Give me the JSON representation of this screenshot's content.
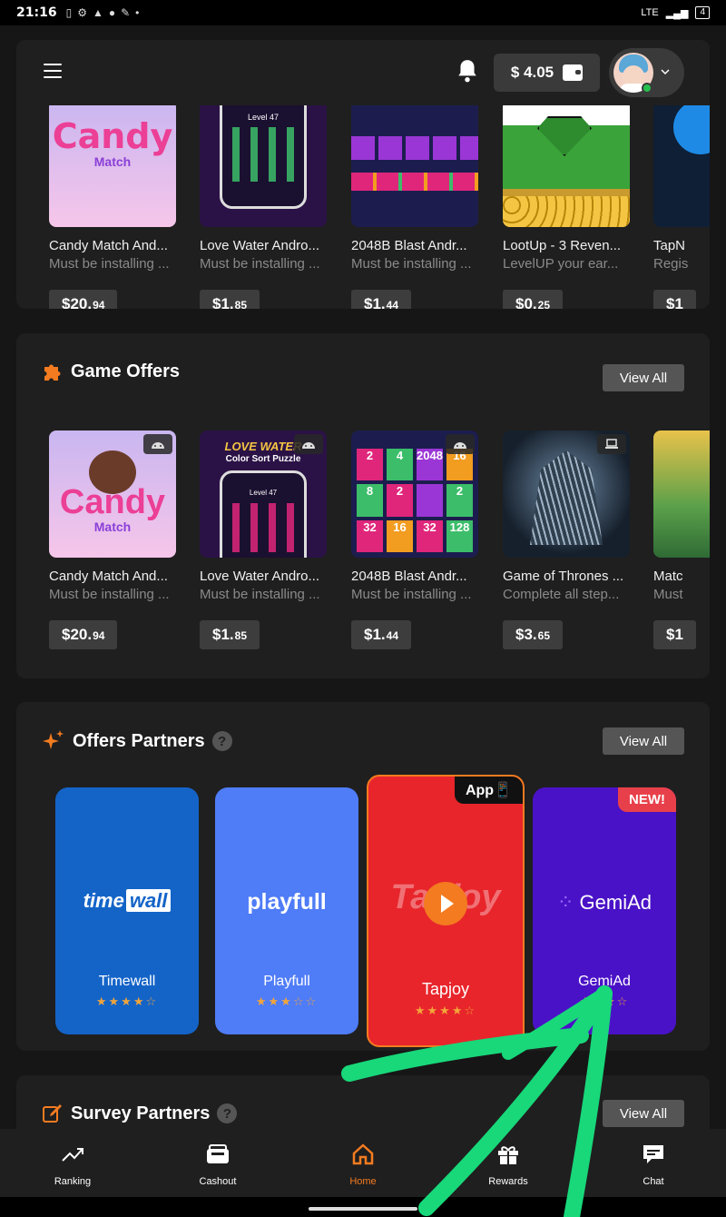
{
  "status_bar": {
    "time": "21:16",
    "network": "LTE",
    "battery": "4"
  },
  "header": {
    "balance": "$ 4.05"
  },
  "top_offers": {
    "cards": [
      {
        "title": "Candy Match And...",
        "subtitle": "Must be installing ...",
        "price_main": "$20.",
        "price_cents": "94"
      },
      {
        "title": "Love Water Andro...",
        "subtitle": "Must be installing ...",
        "price_main": "$1.",
        "price_cents": "85"
      },
      {
        "title": "2048B Blast Andr...",
        "subtitle": "Must be installing ...",
        "price_main": "$1.",
        "price_cents": "44"
      },
      {
        "title": "LootUp - 3 Reven...",
        "subtitle": "LevelUP your ear...",
        "price_main": "$0.",
        "price_cents": "25"
      },
      {
        "title": "TapN",
        "subtitle": "Regis",
        "price_main": "$1",
        "price_cents": ""
      }
    ]
  },
  "game_offers": {
    "title": "Game Offers",
    "view_all": "View All",
    "cards": [
      {
        "title": "Candy Match And...",
        "subtitle": "Must be installing ...",
        "price_main": "$20.",
        "price_cents": "94",
        "platform": "android-icon"
      },
      {
        "title": "Love Water Andro...",
        "subtitle": "Must be installing ...",
        "price_main": "$1.",
        "price_cents": "85",
        "platform": "android-icon"
      },
      {
        "title": "2048B Blast Andr...",
        "subtitle": "Must be installing ...",
        "price_main": "$1.",
        "price_cents": "44",
        "platform": "android-icon"
      },
      {
        "title": "Game of Thrones ...",
        "subtitle": "Complete all step...",
        "price_main": "$3.",
        "price_cents": "65",
        "platform": "laptop-icon"
      },
      {
        "title": "Matc",
        "subtitle": "Must",
        "price_main": "$1",
        "price_cents": ""
      }
    ],
    "thumb_text": {
      "candy_1": "Candy",
      "candy_2": "Match",
      "water_1": "LOVE WATER",
      "water_2": "Color Sort Puzzle",
      "water_level": "Level 47",
      "blast_tiles": [
        "2",
        "4",
        "8",
        "2",
        "2048",
        "16",
        "2",
        "32",
        "16",
        "32",
        "128",
        "2"
      ]
    }
  },
  "offer_partners": {
    "title": "Offers Partners",
    "help": "?",
    "view_all": "View All",
    "partners": [
      {
        "name": "Timewall",
        "logo_a": "time",
        "logo_b": "wall",
        "rating": "★★★★",
        "rating_off": "☆",
        "color": "#1464c8"
      },
      {
        "name": "Playfull",
        "logo": "playfull",
        "rating": "★★★",
        "rating_off": "☆☆",
        "color": "#4f7cf7"
      },
      {
        "name": "Tapjoy",
        "logo": "Tapjoy",
        "badge": "App📱",
        "rating": "★★★★",
        "rating_off": "☆",
        "color": "#e8252b"
      },
      {
        "name": "GemiAd",
        "logo": "GemiAd",
        "badge": "NEW!",
        "rating": "★★★",
        "rating_off": "☆",
        "color": "#4a12c7"
      }
    ]
  },
  "survey_partners": {
    "title": "Survey Partners",
    "help": "?",
    "view_all": "View All"
  },
  "bottom_nav": [
    {
      "label": "Ranking",
      "icon": "trend-icon"
    },
    {
      "label": "Cashout",
      "icon": "wallet-icon"
    },
    {
      "label": "Home",
      "icon": "home-icon",
      "active": true
    },
    {
      "label": "Rewards",
      "icon": "gift-icon"
    },
    {
      "label": "Chat",
      "icon": "chat-icon"
    }
  ],
  "colors": {
    "accent": "#f47b20",
    "panel": "#1f1f1f",
    "background": "#161616",
    "arrow": "#18d87a"
  }
}
